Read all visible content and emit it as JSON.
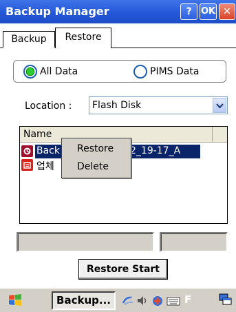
{
  "window": {
    "title": "Backup Manager",
    "help_label": "?",
    "ok_label": "OK",
    "close_label": "✕"
  },
  "tabs": [
    {
      "label": "Backup"
    },
    {
      "label": "Restore"
    }
  ],
  "radio": {
    "all_label": "All Data",
    "pims_label": "PIMS Data",
    "selected": "All Data"
  },
  "location": {
    "label": "Location :",
    "value": "Flash Disk"
  },
  "list": {
    "header": "Name",
    "items": [
      {
        "text": "Back",
        "tail": "2_19-17_A"
      },
      {
        "text": "업체"
      }
    ]
  },
  "context_menu": [
    "Restore",
    "Delete"
  ],
  "buttons": {
    "restore_start": "Restore Start"
  },
  "taskbar": {
    "task_label": "Backup..."
  }
}
